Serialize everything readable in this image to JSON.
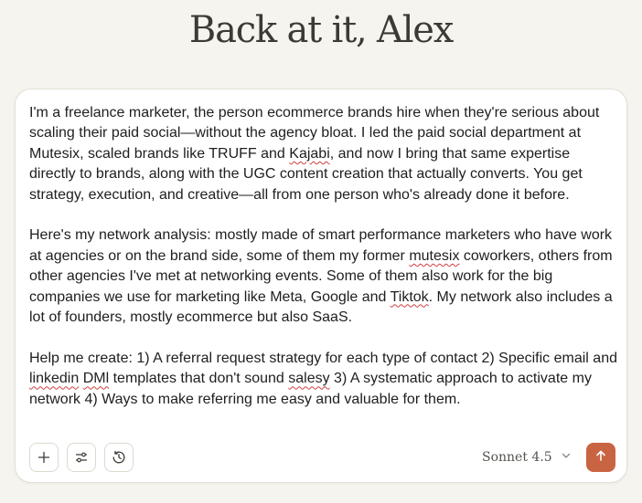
{
  "greeting": "Back at it, Alex",
  "prompt": {
    "p1": "I'm a freelance marketer, the person ecommerce brands hire when they're serious about scaling their paid social—without the agency bloat. I led the paid social department at Mutesix, scaled brands like TRUFF and ",
    "p1_word": "Kajabi",
    "p1_end": ", and now I bring that same expertise directly to brands, along with the UGC content creation that actually converts. You get strategy, execution, and creative—all from one person who's already done it before.",
    "p2_a": "Here's my network analysis: mostly made of smart performance marketers who have work at agencies or on the brand side, some of them my former ",
    "p2_word1": "mutesix",
    "p2_b": " coworkers, others from other agencies I've met at networking events. Some of them also work for the big companies we use for marketing like Meta, Google and ",
    "p2_word2": "Tiktok",
    "p2_c": ". My network also includes a lot of founders, mostly ecommerce but also SaaS.",
    "p3_a": "Help me create: 1) A referral request strategy for each type of contact 2) Specific email and ",
    "p3_word1": "linkedin",
    "p3_sp": " ",
    "p3_word2": "DMl",
    "p3_b": " templates that don't sound ",
    "p3_word3": "salesy",
    "p3_c": " 3) A systematic approach to activate my network 4) Ways to make referring me easy and valuable for them."
  },
  "toolbar": {
    "add_icon": "plus-icon",
    "tools_icon": "sliders-icon",
    "history_icon": "history-clock-icon"
  },
  "model": {
    "label": "Sonnet 4.5",
    "icon": "chevron-down-icon"
  },
  "send": {
    "icon": "arrow-up-icon",
    "color": "#c96442"
  }
}
